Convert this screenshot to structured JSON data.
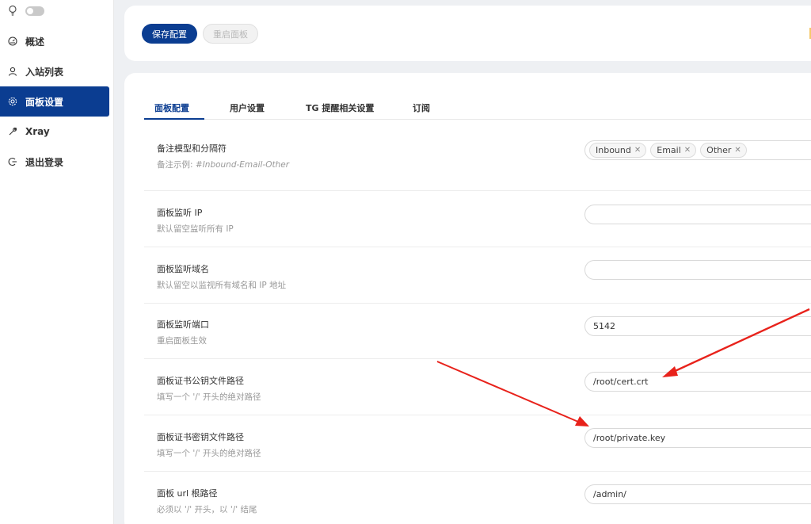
{
  "sidebar": {
    "items": [
      {
        "label": "概述",
        "icon": "dashboard-icon"
      },
      {
        "label": "入站列表",
        "icon": "user-icon"
      },
      {
        "label": "面板设置",
        "icon": "gear-icon",
        "active": true
      },
      {
        "label": "Xray",
        "icon": "wrench-icon"
      },
      {
        "label": "退出登录",
        "icon": "logout-icon"
      }
    ]
  },
  "toolbar": {
    "save_label": "保存配置",
    "restart_label": "重启面板"
  },
  "tabs": [
    {
      "label": "面板配置",
      "active": true
    },
    {
      "label": "用户设置"
    },
    {
      "label": "TG 提醒相关设置"
    },
    {
      "label": "订阅"
    }
  ],
  "settings": {
    "remark": {
      "title": "备注模型和分隔符",
      "desc_prefix": "备注示例: ",
      "desc_example": "#Inbound-Email-Other",
      "tags": [
        "Inbound",
        "Email",
        "Other"
      ]
    },
    "listen_ip": {
      "title": "面板监听 IP",
      "desc": "默认留空监听所有 IP",
      "value": ""
    },
    "listen_domain": {
      "title": "面板监听域名",
      "desc": "默认留空以监视所有域名和 IP 地址",
      "value": ""
    },
    "listen_port": {
      "title": "面板监听端口",
      "desc": "重启面板生效",
      "value": "5142"
    },
    "cert_path": {
      "title": "面板证书公钥文件路径",
      "desc": "填写一个 '/' 开头的绝对路径",
      "value": "/root/cert.crt"
    },
    "key_path": {
      "title": "面板证书密钥文件路径",
      "desc": "填写一个 '/' 开头的绝对路径",
      "value": "/root/private.key"
    },
    "base_path": {
      "title": "面板 url 根路径",
      "desc": "必须以 '/' 开头，以 '/' 结尾",
      "value": "/admin/"
    }
  },
  "colors": {
    "accent": "#0b3d91",
    "annotation_arrow": "#e8221b"
  }
}
